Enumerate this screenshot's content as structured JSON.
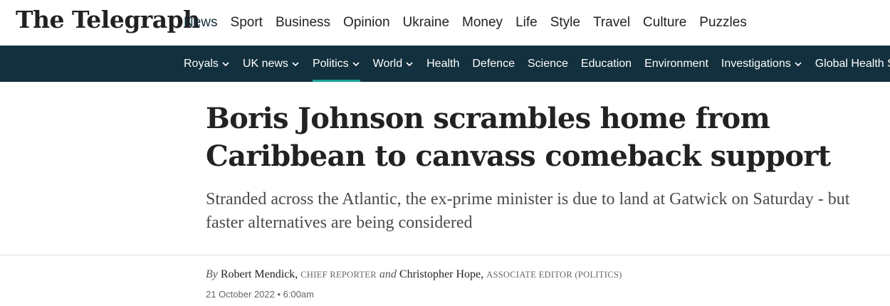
{
  "masthead": {
    "logo_text": "The Telegraph"
  },
  "primary_nav": [
    {
      "label": "News",
      "active": true
    },
    {
      "label": "Sport"
    },
    {
      "label": "Business"
    },
    {
      "label": "Opinion"
    },
    {
      "label": "Ukraine"
    },
    {
      "label": "Money"
    },
    {
      "label": "Life"
    },
    {
      "label": "Style"
    },
    {
      "label": "Travel"
    },
    {
      "label": "Culture"
    },
    {
      "label": "Puzzles"
    }
  ],
  "secondary_nav": [
    {
      "label": "Royals",
      "dropdown": true
    },
    {
      "label": "UK news",
      "dropdown": true
    },
    {
      "label": "Politics",
      "dropdown": true,
      "active": true
    },
    {
      "label": "World",
      "dropdown": true
    },
    {
      "label": "Health"
    },
    {
      "label": "Defence"
    },
    {
      "label": "Science"
    },
    {
      "label": "Education"
    },
    {
      "label": "Environment"
    },
    {
      "label": "Investigations",
      "dropdown": true
    },
    {
      "label": "Global Health Security"
    }
  ],
  "article": {
    "headline": "Boris Johnson scrambles home from Caribbean to canvass comeback support",
    "standfirst": "Stranded across the Atlantic, the ex-prime minister is due to land at Gatwick on Saturday - but faster alternatives are being considered",
    "byline": {
      "by": "By",
      "author1": "Robert Mendick,",
      "role1": "CHIEF REPORTER",
      "and": "and",
      "author2": "Christopher Hope,",
      "role2": "ASSOCIATE EDITOR (POLITICS)"
    },
    "date": "21 October 2022 • 6:00am"
  },
  "colors": {
    "secondary_nav_bg": "#12303d",
    "active_underline": "#1aa39a",
    "headline": "#222222"
  },
  "icons": {
    "dropdown": "chevron-down-icon"
  }
}
